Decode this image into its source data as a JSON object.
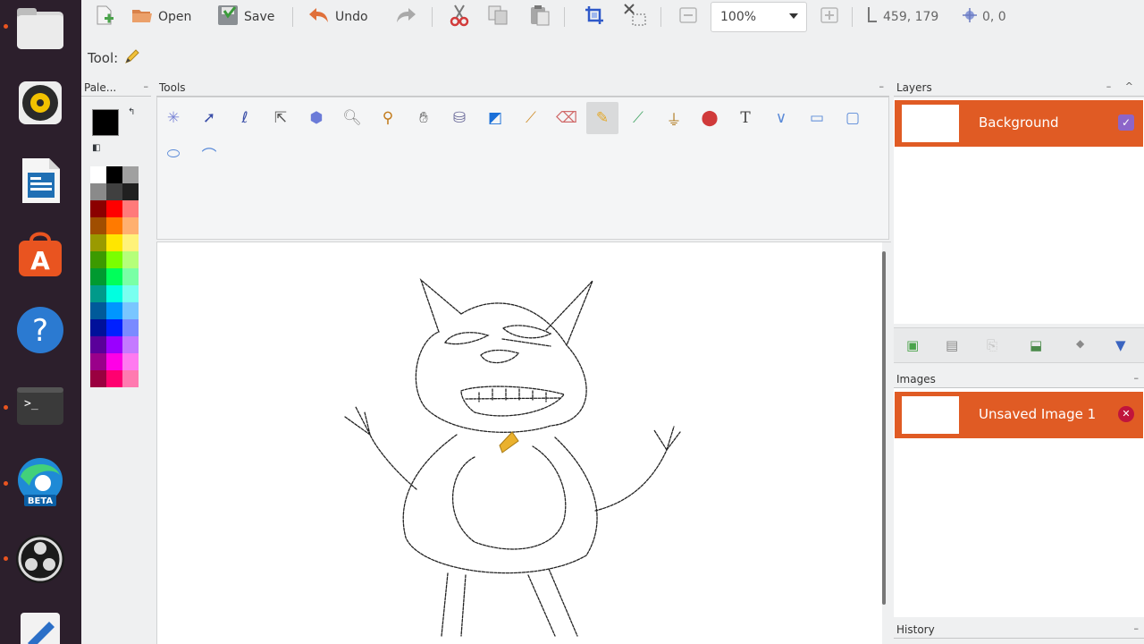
{
  "toolbar": {
    "open_label": "Open",
    "save_label": "Save",
    "undo_label": "Undo",
    "zoom_value": "100%",
    "cursor_position": "459, 179",
    "selection_size": "0, 0"
  },
  "toolrow": {
    "label": "Tool:"
  },
  "panels": {
    "palette_title": "Pale...",
    "tools_title": "Tools",
    "layers_title": "Layers",
    "images_title": "Images",
    "history_title": "History"
  },
  "layers": [
    {
      "name": "Background",
      "visible": true
    }
  ],
  "images": [
    {
      "name": "Unsaved Image 1"
    }
  ],
  "colors": {
    "accent": "#e05b24",
    "primary": "#000000",
    "secondary": "#ffffff"
  }
}
